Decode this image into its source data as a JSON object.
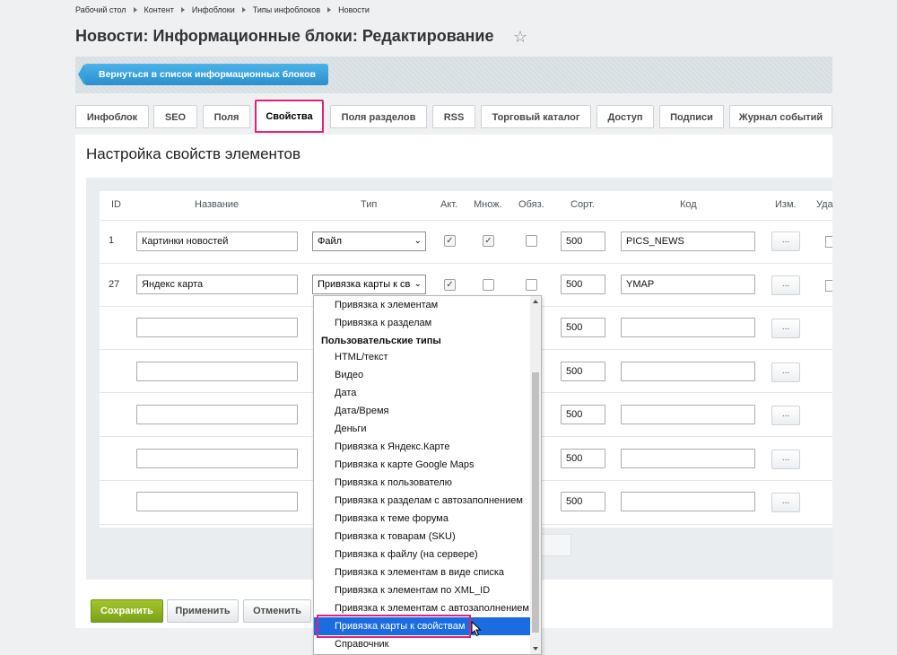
{
  "breadcrumb": [
    "Рабочий стол",
    "Контент",
    "Инфоблоки",
    "Типы инфоблоков",
    "Новости"
  ],
  "page_title": "Новости: Информационные блоки: Редактирование",
  "back_button": "Вернуться в список информационных блоков",
  "tabs": [
    {
      "label": "Инфоблок",
      "active": false
    },
    {
      "label": "SEO",
      "active": false
    },
    {
      "label": "Поля",
      "active": false
    },
    {
      "label": "Свойства",
      "active": true
    },
    {
      "label": "Поля разделов",
      "active": false
    },
    {
      "label": "RSS",
      "active": false
    },
    {
      "label": "Торговый каталог",
      "active": false
    },
    {
      "label": "Доступ",
      "active": false
    },
    {
      "label": "Подписи",
      "active": false
    },
    {
      "label": "Журнал событий",
      "active": false
    }
  ],
  "section_title": "Настройка свойств элементов",
  "table": {
    "headers": [
      "ID",
      "Название",
      "Тип",
      "Акт.",
      "Множ.",
      "Обяз.",
      "Сорт.",
      "Код",
      "Изм.",
      "Уда"
    ],
    "rows": [
      {
        "id": "1",
        "name": "Картинки новостей",
        "type": "Файл",
        "active": true,
        "multiple": true,
        "required": false,
        "sort": "500",
        "code": "PICS_NEWS",
        "edit": "..."
      },
      {
        "id": "27",
        "name": "Яндекс карта",
        "type": "Привязка карты к св",
        "active": true,
        "multiple": false,
        "required": false,
        "sort": "500",
        "code": "YMAP",
        "edit": "..."
      },
      {
        "id": "",
        "name": "",
        "sort": "500",
        "code": "",
        "edit": "..."
      },
      {
        "id": "",
        "name": "",
        "sort": "500",
        "code": "",
        "edit": "..."
      },
      {
        "id": "",
        "name": "",
        "sort": "500",
        "code": "",
        "edit": "..."
      },
      {
        "id": "",
        "name": "",
        "sort": "500",
        "code": "",
        "edit": "..."
      },
      {
        "id": "",
        "name": "",
        "sort": "500",
        "code": "",
        "edit": "..."
      }
    ]
  },
  "dropdown": {
    "items": [
      {
        "kind": "item",
        "label": "Привязка к элементам"
      },
      {
        "kind": "item",
        "label": "Привязка к разделам"
      },
      {
        "kind": "group",
        "label": "Пользовательские типы"
      },
      {
        "kind": "item",
        "label": "HTML/текст"
      },
      {
        "kind": "item",
        "label": "Видео"
      },
      {
        "kind": "item",
        "label": "Дата"
      },
      {
        "kind": "item",
        "label": "Дата/Время"
      },
      {
        "kind": "item",
        "label": "Деньги"
      },
      {
        "kind": "item",
        "label": "Привязка к Яндекс.Карте"
      },
      {
        "kind": "item",
        "label": "Привязка к карте Google Maps"
      },
      {
        "kind": "item",
        "label": "Привязка к пользователю"
      },
      {
        "kind": "item",
        "label": "Привязка к разделам с автозаполнением"
      },
      {
        "kind": "item",
        "label": "Привязка к теме форума"
      },
      {
        "kind": "item",
        "label": "Привязка к товарам (SKU)"
      },
      {
        "kind": "item",
        "label": "Привязка к файлу (на сервере)"
      },
      {
        "kind": "item",
        "label": "Привязка к элементам в виде списка"
      },
      {
        "kind": "item",
        "label": "Привязка к элементам по XML_ID"
      },
      {
        "kind": "item",
        "label": "Привязка к элементам с автозаполнением"
      },
      {
        "kind": "item",
        "label": "Привязка карты к свойствам",
        "selected": true
      },
      {
        "kind": "item",
        "label": "Справочник"
      }
    ]
  },
  "footer": {
    "save": "Сохранить",
    "apply": "Применить",
    "cancel": "Отменить"
  },
  "colors": {
    "accent_highlight": "#e0237a",
    "save_green": "#8cb321",
    "back_blue": "#2a8fcf",
    "selected_blue": "#1a6ce0"
  }
}
